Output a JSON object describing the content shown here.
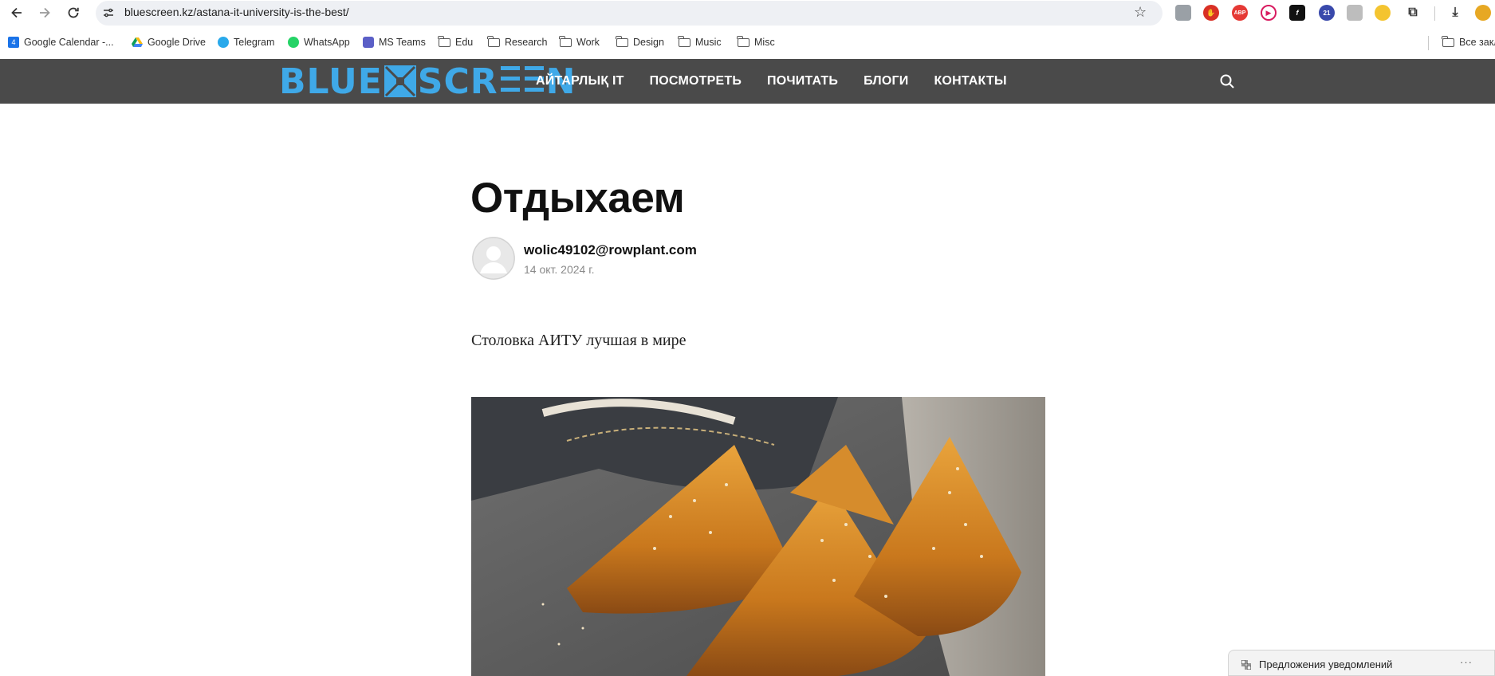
{
  "browser": {
    "url": "bluescreen.kz/astana-it-university-is-the-best/",
    "extension_badge": "21",
    "adblock_label": "ABP",
    "bookmarks": [
      {
        "label": "Google Calendar -...",
        "icon": "calendar-icon"
      },
      {
        "label": "Google Drive",
        "icon": "drive-icon"
      },
      {
        "label": "Telegram",
        "icon": "telegram-icon"
      },
      {
        "label": "WhatsApp",
        "icon": "whatsapp-icon"
      },
      {
        "label": "MS Teams",
        "icon": "teams-icon"
      },
      {
        "label": "Edu",
        "icon": "folder-icon"
      },
      {
        "label": "Research",
        "icon": "folder-icon"
      },
      {
        "label": "Work",
        "icon": "folder-icon"
      },
      {
        "label": "Design",
        "icon": "folder-icon"
      },
      {
        "label": "Music",
        "icon": "folder-icon"
      },
      {
        "label": "Misc",
        "icon": "folder-icon"
      }
    ],
    "all_bookmarks_label": "Все закл"
  },
  "site": {
    "logo": {
      "left": "BLUE",
      "right": "SCR",
      "end": "N"
    },
    "menu": [
      "АЙТАРЛЫҚ IT",
      "ПОСМОТРЕТЬ",
      "ПОЧИТАТЬ",
      "БЛОГИ",
      "КОНТАКТЫ"
    ],
    "accent_color": "#3fa9e8",
    "header_color": "#4a4a4a"
  },
  "article": {
    "title": "Отдыхаем",
    "author": "wolic49102@rowplant.com",
    "date": "14 окт. 2024 г.",
    "body": "Столовка АИТУ лучшая в мире"
  },
  "notification": {
    "text": "Предложения уведомлений",
    "more": "···"
  }
}
